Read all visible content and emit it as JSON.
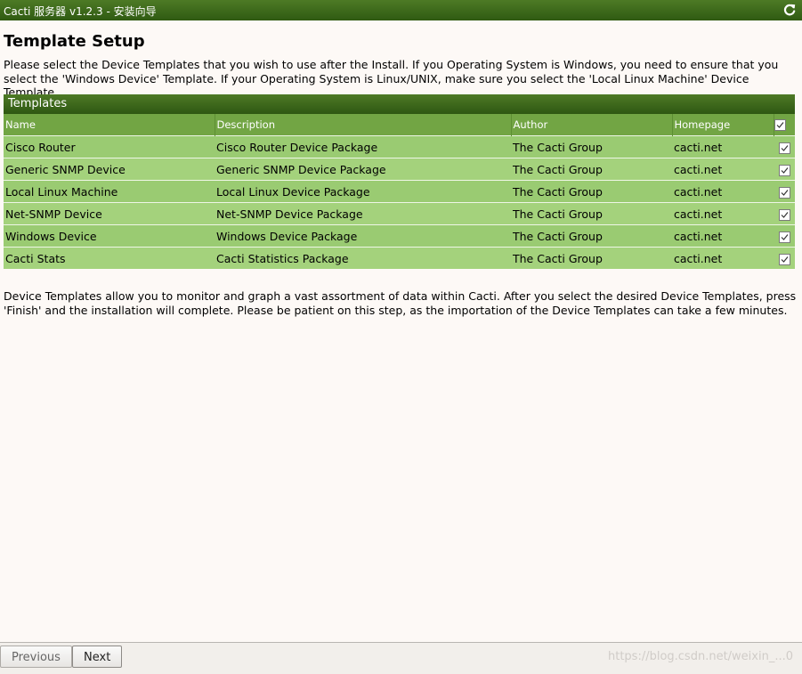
{
  "window": {
    "title": "Cacti 服务器 v1.2.3 - 安装向导",
    "refresh_icon": "refresh-icon"
  },
  "page": {
    "heading": "Template Setup",
    "intro": "Please select the Device Templates that you wish to use after the Install. If you Operating System is Windows, you need to ensure that you select the 'Windows Device' Template. If your Operating System is Linux/UNIX, make sure you select the 'Local Linux Machine' Device Template.",
    "outro": "Device Templates allow you to monitor and graph a vast assortment of data within Cacti. After you select the desired Device Templates, press 'Finish' and the installation will complete. Please be patient on this step, as the importation of the Device Templates can take a few minutes."
  },
  "templates": {
    "header": "Templates",
    "columns": [
      "Name",
      "Description",
      "Author",
      "Homepage"
    ],
    "select_all_checked": true,
    "rows": [
      {
        "name": "Cisco Router",
        "description": "Cisco Router Device Package",
        "author": "The Cacti Group",
        "homepage": "cacti.net",
        "checked": true
      },
      {
        "name": "Generic SNMP Device",
        "description": "Generic SNMP Device Package",
        "author": "The Cacti Group",
        "homepage": "cacti.net",
        "checked": true
      },
      {
        "name": "Local Linux Machine",
        "description": "Local Linux Device Package",
        "author": "The Cacti Group",
        "homepage": "cacti.net",
        "checked": true
      },
      {
        "name": "Net-SNMP Device",
        "description": "Net-SNMP Device Package",
        "author": "The Cacti Group",
        "homepage": "cacti.net",
        "checked": true
      },
      {
        "name": "Windows Device",
        "description": "Windows Device Package",
        "author": "The Cacti Group",
        "homepage": "cacti.net",
        "checked": true
      },
      {
        "name": "Cacti Stats",
        "description": "Cacti Statistics Package",
        "author": "The Cacti Group",
        "homepage": "cacti.net",
        "checked": true
      }
    ]
  },
  "footer": {
    "previous_label": "Previous",
    "next_label": "Next",
    "watermark": "https://blog.csdn.net/weixin_...0"
  },
  "colors": {
    "titlebar": "#3b6a19",
    "header_row": "#72a544",
    "row": "#9acb72",
    "background": "#fdf9f6"
  }
}
